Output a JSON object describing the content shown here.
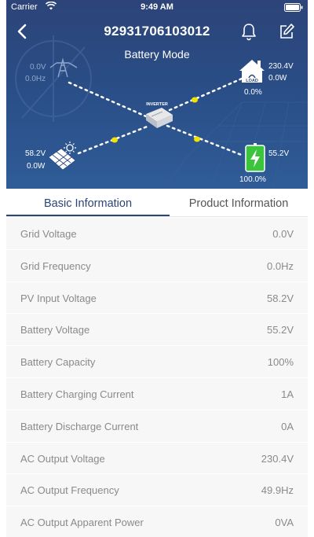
{
  "status_bar": {
    "carrier": "Carrier",
    "time": "9:49 AM"
  },
  "header": {
    "title": "92931706103012",
    "mode": "Battery Mode"
  },
  "flow": {
    "grid": {
      "voltage": "0.0V",
      "frequency": "0.0Hz"
    },
    "load": {
      "voltage": "230.4V",
      "power": "0.0W",
      "percent": "0.0%",
      "icon_text": "LOAD"
    },
    "inverter_label": "INVERTER",
    "pv": {
      "voltage": "58.2V",
      "power": "0.0W"
    },
    "battery": {
      "voltage": "55.2V",
      "percent": "100.0%"
    }
  },
  "tabs": [
    {
      "label": "Basic Information",
      "active": true
    },
    {
      "label": "Product Information",
      "active": false
    }
  ],
  "rows": [
    {
      "label": "Grid Voltage",
      "value": "0.0V"
    },
    {
      "label": "Grid Frequency",
      "value": "0.0Hz"
    },
    {
      "label": "PV Input Voltage",
      "value": "58.2V"
    },
    {
      "label": "Battery Voltage",
      "value": "55.2V"
    },
    {
      "label": "Battery Capacity",
      "value": "100%"
    },
    {
      "label": "Battery Charging Current",
      "value": "1A"
    },
    {
      "label": "Battery Discharge Current",
      "value": "0A"
    },
    {
      "label": "AC Output Voltage",
      "value": "230.4V"
    },
    {
      "label": "AC Output Frequency",
      "value": "49.9Hz"
    },
    {
      "label": "AC Output Apparent Power",
      "value": "0VA"
    }
  ],
  "colors": {
    "header_bg": "#2c4478",
    "accent": "#2a4677",
    "flow_dot": "#f2e200",
    "battery_green": "#3cc43c"
  },
  "icons": [
    "wifi-icon",
    "battery-status-icon",
    "back-icon",
    "bell-icon",
    "edit-icon",
    "grid-tower-icon",
    "house-load-icon",
    "inverter-icon",
    "solar-panel-icon",
    "battery-icon"
  ]
}
